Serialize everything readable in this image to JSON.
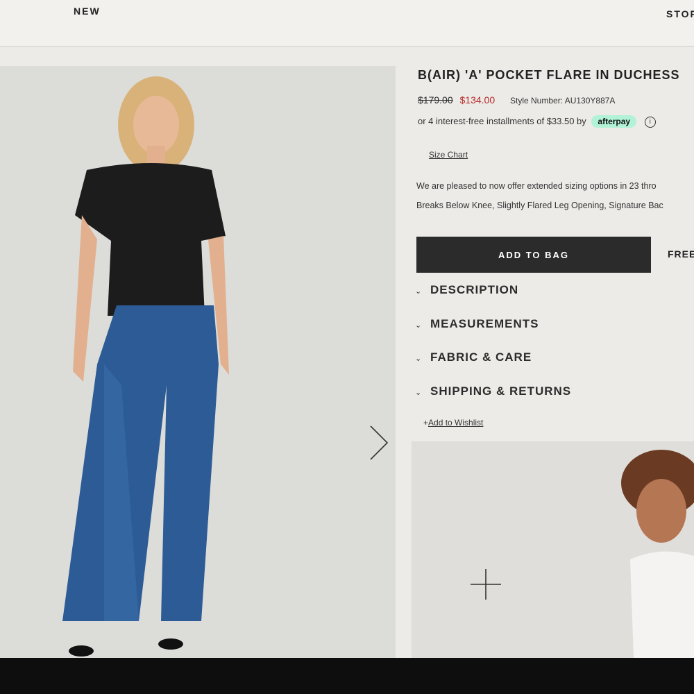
{
  "nav": {
    "new_label": "NEW",
    "stores_label": "STOR"
  },
  "product": {
    "title": "B(AIR) 'A' POCKET FLARE IN DUCHESS",
    "original_price": "$179.00",
    "sale_price": "$134.00",
    "style_number": "Style Number: AU130Y887A",
    "afterpay": {
      "text": "or 4 interest-free installments of $33.50 by",
      "badge": "afterpay",
      "info_icon": "ⓘ"
    },
    "size_chart_label": "Size Chart",
    "note_line1": "We are pleased to now offer extended sizing options in 23 thro",
    "note_line2": "Breaks Below Knee, Slightly Flared Leg Opening, Signature Bac",
    "add_to_bag_label": "ADD TO BAG",
    "free_label": "FREE",
    "accordion": [
      {
        "label": "DESCRIPTION",
        "icon": "chevron-down-icon"
      },
      {
        "label": "MEASUREMENTS",
        "icon": "chevron-down-icon"
      },
      {
        "label": "FABRIC & CARE",
        "icon": "chevron-down-icon"
      },
      {
        "label": "SHIPPING & RETURNS",
        "icon": "chevron-down-icon"
      }
    ],
    "wishlist_prefix": "+",
    "wishlist_label": "Add to Wishlist"
  },
  "gallery": {
    "next_icon": "chevron-right-icon",
    "zoom_icon": "plus-icon"
  },
  "colors": {
    "sale_red": "#b52a2a",
    "button_dark": "#2b2b2b",
    "afterpay_mint": "#b2f2d7",
    "background": "#ecebe8"
  }
}
